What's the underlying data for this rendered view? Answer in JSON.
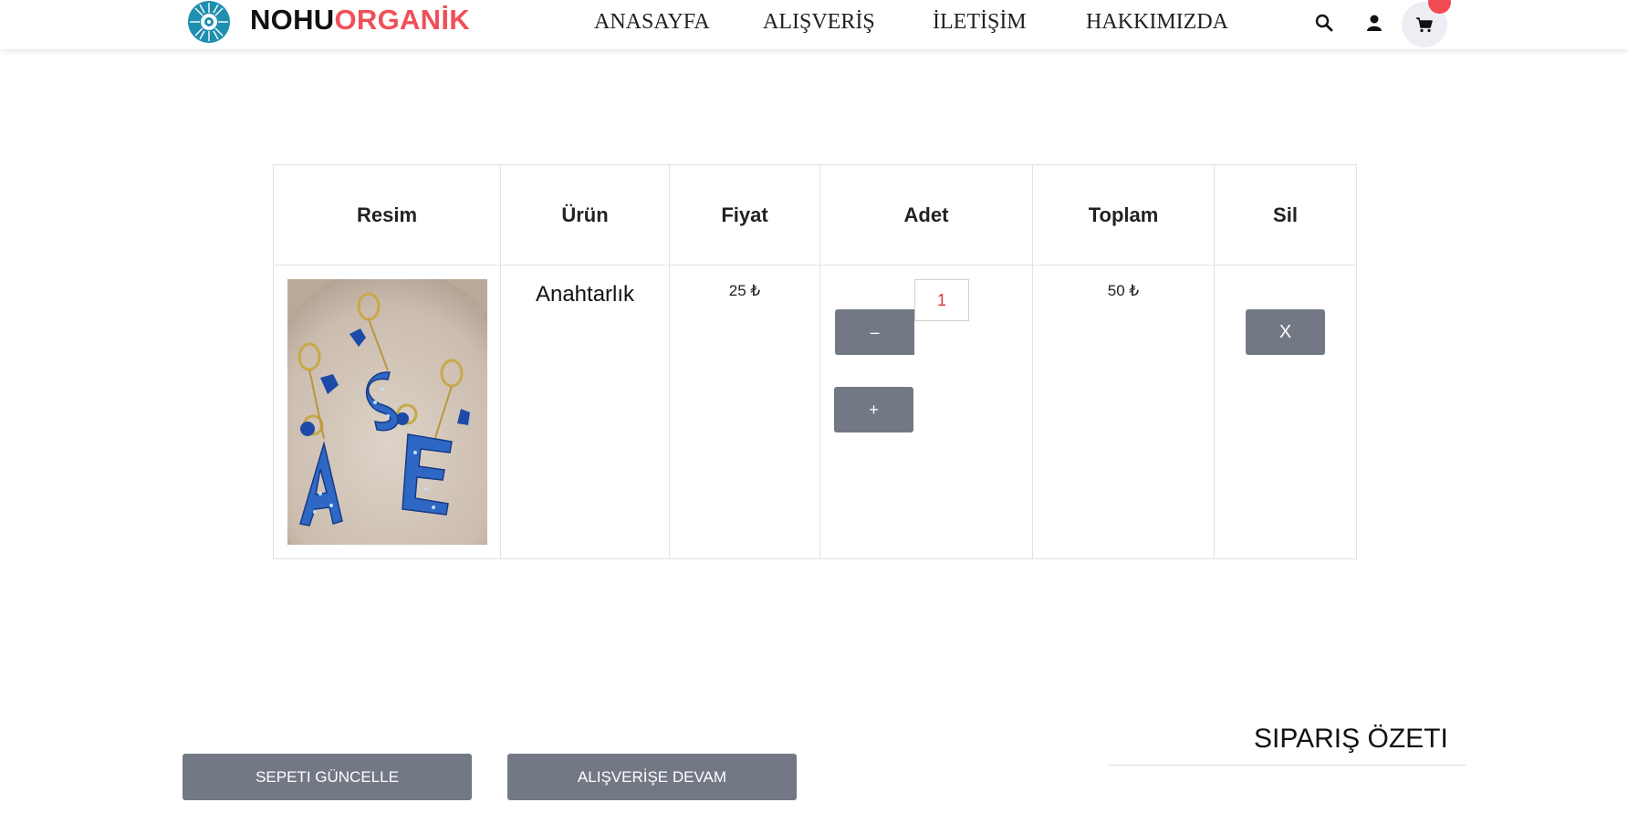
{
  "brand": {
    "part1": "NOHU",
    "part2": "ORGANİK",
    "accent_color": "#f0505a"
  },
  "nav": {
    "items": [
      {
        "label": "ANASAYFA"
      },
      {
        "label": "ALIŞVERİŞ"
      },
      {
        "label": "İLETİŞİM"
      },
      {
        "label": "HAKKIMIZDA"
      }
    ]
  },
  "header_icons": [
    "search-icon",
    "user-icon",
    "cart-icon"
  ],
  "cart_table": {
    "headers": [
      "Resim",
      "Ürün",
      "Fiyat",
      "Adet",
      "Toplam",
      "Sil"
    ],
    "rows": [
      {
        "image_icon": "keychain-product-photo",
        "product": "Anahtarlık",
        "price": "25 ₺",
        "quantity": "1",
        "decrement_label": "–",
        "increment_label": "+",
        "total": "50 ₺",
        "delete_label": "X"
      }
    ]
  },
  "actions": {
    "update_cart": "SEPETI GÜNCELLE",
    "continue_shopping": "ALIŞVERİŞE DEVAM"
  },
  "summary": {
    "title": "SIPARIŞ ÖZETI"
  },
  "colors": {
    "button_gray": "#737885",
    "badge_red": "#f24a53",
    "quantity_text": "#d9393f"
  }
}
